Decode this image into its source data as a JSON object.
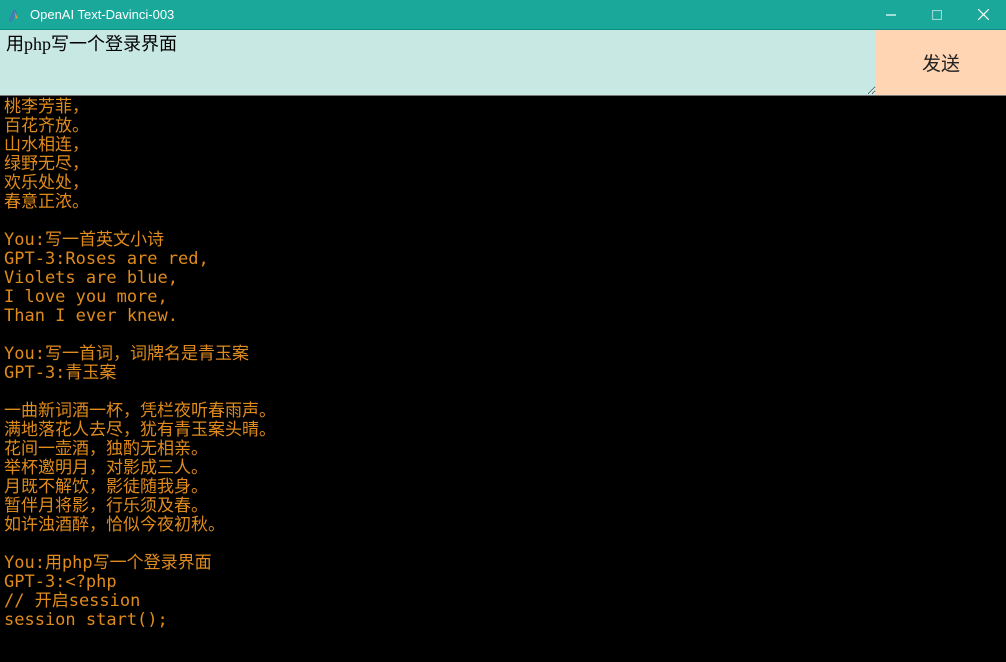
{
  "titlebar": {
    "title": "OpenAI Text-Davinci-003"
  },
  "input": {
    "value": "用php写一个登录界面"
  },
  "send_button": {
    "label": "发送"
  },
  "conversation": {
    "text": "桃李芳菲，\n百花齐放。\n山水相连，\n绿野无尽，\n欢乐处处，\n春意正浓。\n\nYou:写一首英文小诗\nGPT-3:Roses are red,\nViolets are blue,\nI love you more,\nThan I ever knew.\n\nYou:写一首词，词牌名是青玉案\nGPT-3:青玉案\n\n一曲新词酒一杯，凭栏夜听春雨声。\n满地落花人去尽，犹有青玉案头晴。\n花间一壶酒，独酌无相亲。\n举杯邀明月，对影成三人。\n月既不解饮，影徒随我身。\n暂伴月将影，行乐须及春。\n如许浊酒醉，恰似今夜初秋。\n\nYou:用php写一个登录界面\nGPT-3:<?php\n// 开启session\nsession start();"
  }
}
